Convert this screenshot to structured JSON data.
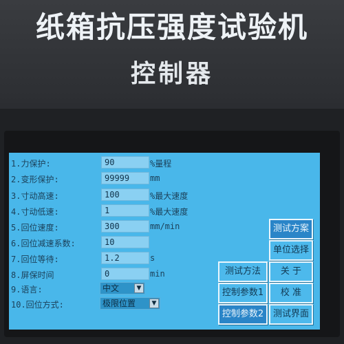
{
  "machine": {
    "title": "纸箱抗压强度试验机",
    "subtitle": "控制器"
  },
  "settings": [
    {
      "label": "1.力保护:",
      "value": "90",
      "unit": "%量程"
    },
    {
      "label": "2.变形保护:",
      "value": "99999",
      "unit": "mm"
    },
    {
      "label": "3.寸动高速:",
      "value": "100",
      "unit": "%最大速度"
    },
    {
      "label": "4.寸动低速:",
      "value": "1",
      "unit": "%最大速度"
    },
    {
      "label": "5.回位速度:",
      "value": "300",
      "unit": "mm/min"
    },
    {
      "label": "6.回位减速系数:",
      "value": "10",
      "unit": ""
    },
    {
      "label": "7.回位等待:",
      "value": "1.2",
      "unit": "s"
    },
    {
      "label": "8.屏保时间",
      "value": "0",
      "unit": "min"
    },
    {
      "label": "9.语言:",
      "selected": "中文"
    },
    {
      "label": "10.回位方式:",
      "selected": "极限位置"
    }
  ],
  "buttons": {
    "test_scheme": "测试方案",
    "unit_select": "单位选择",
    "test_method": "测试方法",
    "about": "关 于",
    "control_param1": "控制参数1",
    "calibrate": "校 准",
    "control_param2": "控制参数2",
    "test_screen": "测试界面"
  },
  "colors": {
    "screen_bg": "#49b7ea",
    "field_bg": "#8ad0f2",
    "active_button": "#2a85c8"
  }
}
